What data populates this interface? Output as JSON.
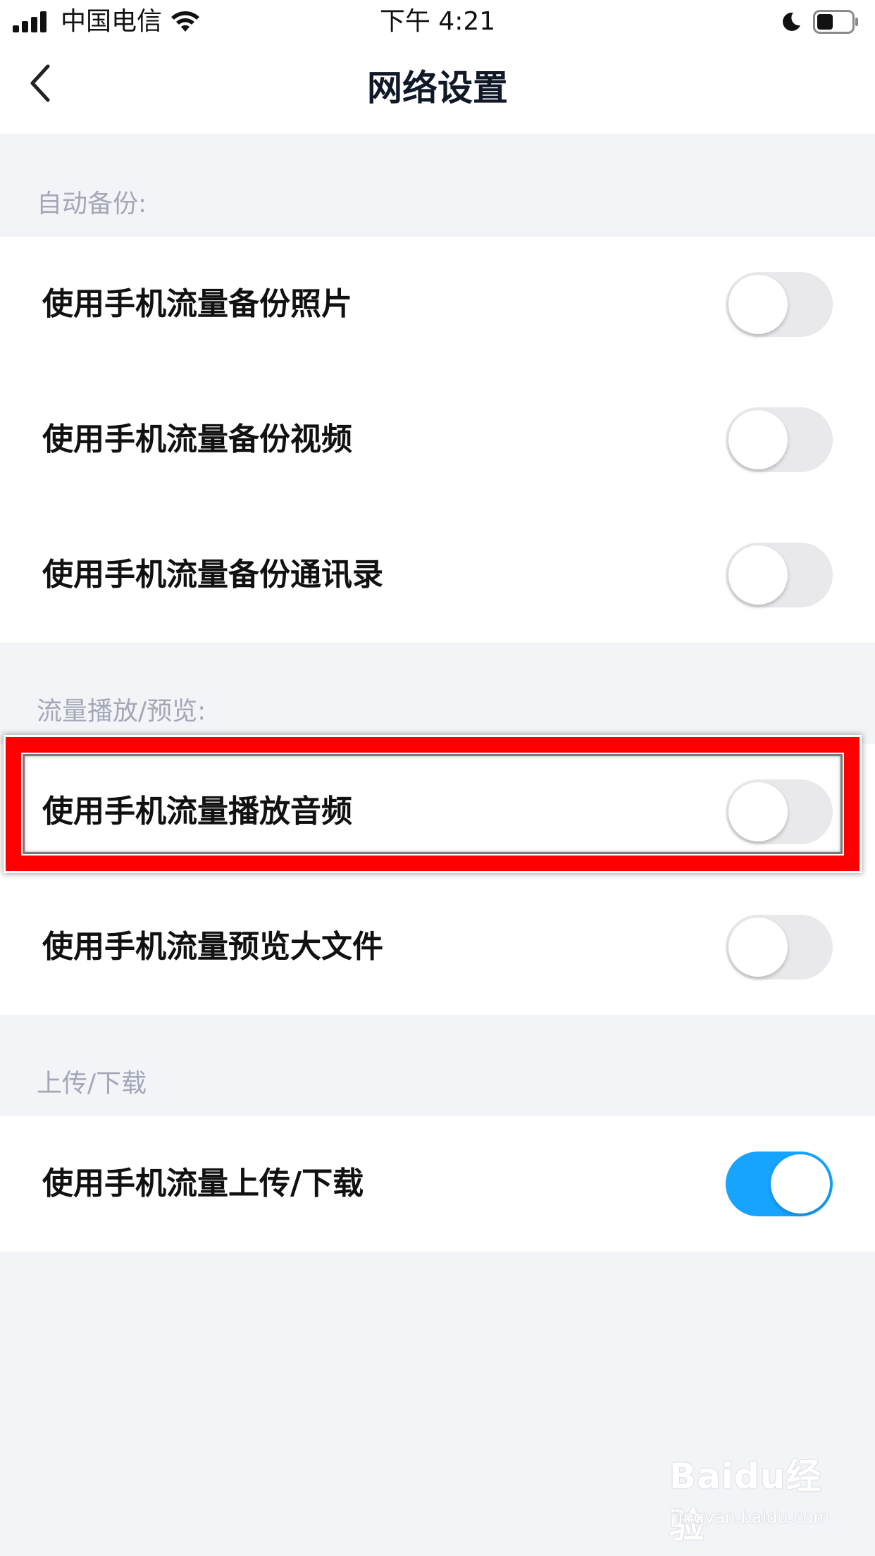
{
  "status_bar": {
    "carrier": "中国电信",
    "time": "下午 4:21"
  },
  "nav": {
    "title": "网络设置"
  },
  "sections": {
    "auto_backup": {
      "header": "自动备份:",
      "rows": [
        {
          "label": "使用手机流量备份照片",
          "on": false
        },
        {
          "label": "使用手机流量备份视频",
          "on": false
        },
        {
          "label": "使用手机流量备份通讯录",
          "on": false
        }
      ]
    },
    "playback": {
      "header": "流量播放/预览:",
      "rows": [
        {
          "label": "使用手机流量播放音频",
          "on": false
        },
        {
          "label": "使用手机流量预览大文件",
          "on": false
        }
      ]
    },
    "transfer": {
      "header": "上传/下载",
      "rows": [
        {
          "label": "使用手机流量上传/下载",
          "on": true
        }
      ]
    }
  },
  "colors": {
    "toggle_on": "#17a4ff",
    "toggle_off": "#e9e9ec",
    "highlight": "#ff0000",
    "header_text": "#a3a8b6"
  },
  "watermark": {
    "logo": "Baidu经验",
    "url": "jingyan.baidu.com"
  }
}
